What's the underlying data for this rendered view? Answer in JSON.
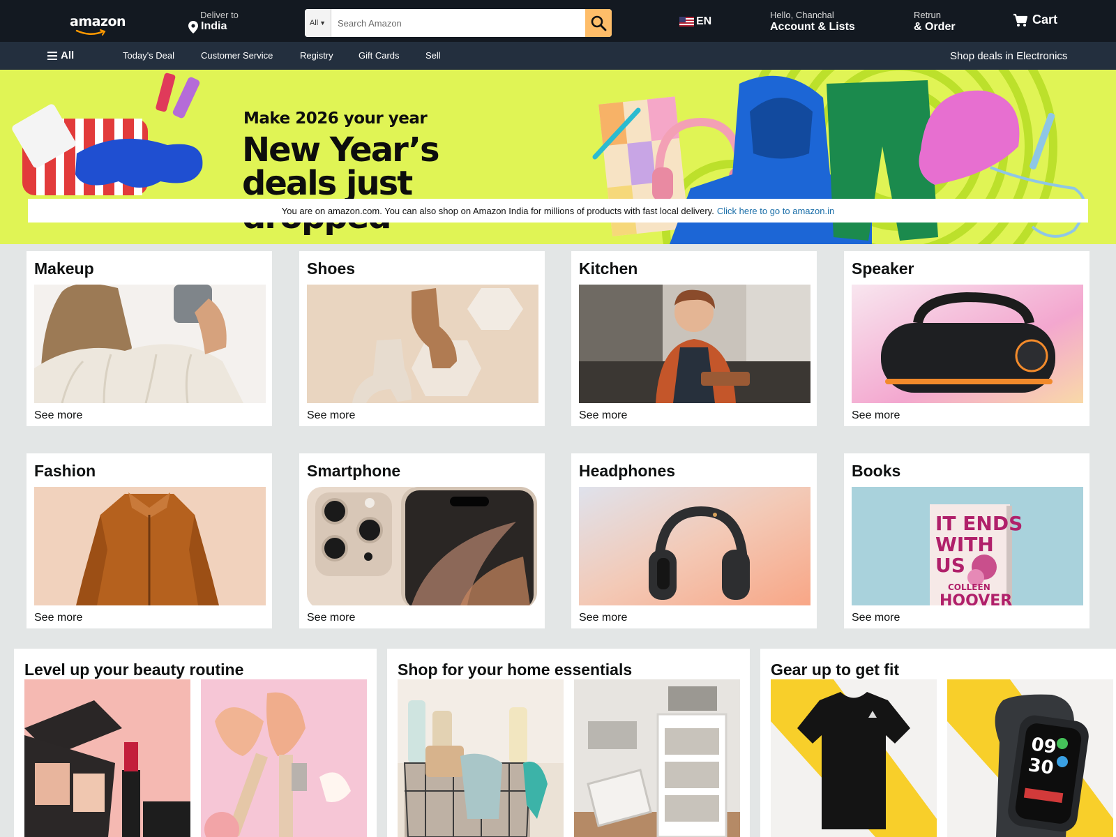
{
  "header": {
    "logo_text": "amazon",
    "deliver_label": "Deliver to",
    "deliver_location": "India",
    "search_category": "All",
    "search_placeholder": "Search Amazon",
    "language": "EN",
    "account_greeting": "Hello, Chanchal",
    "account_label": "Account & Lists",
    "orders_small": "Retrun",
    "orders_big": "& Order",
    "cart_label": "Cart"
  },
  "nav": {
    "all_label": "All",
    "items": [
      "Today's Deal",
      "Customer Service",
      "Registry",
      "Gift Cards",
      "Sell"
    ],
    "promo": "Shop deals in Electronics"
  },
  "hero": {
    "eyebrow": "Make 2026 your year",
    "title": "New Year’s deals just dropped",
    "notice_text": "You are on amazon.com. You can also shop on Amazon India for millions of products with fast local delivery.",
    "notice_link": "Click here to go to amazon.in",
    "background_color": "#e0f455"
  },
  "categories": [
    {
      "title": "Makeup",
      "link": "See more"
    },
    {
      "title": "Shoes",
      "link": "See more"
    },
    {
      "title": "Kitchen",
      "link": "See more"
    },
    {
      "title": "Speaker",
      "link": "See more"
    },
    {
      "title": "Fashion",
      "link": "See more"
    },
    {
      "title": "Smartphone",
      "link": "See more"
    },
    {
      "title": "Headphones",
      "link": "See more"
    },
    {
      "title": "Books",
      "link": "See more"
    }
  ],
  "book_cover": {
    "title": "IT ENDS WITH US",
    "author": "COLLEEN HOOVER"
  },
  "watch_face": {
    "hour": "09",
    "minute": "30"
  },
  "panels": [
    {
      "title": "Level up your beauty routine"
    },
    {
      "title": "Shop for your home essentials"
    },
    {
      "title": "Gear up to get fit"
    }
  ],
  "colors": {
    "header_bg": "#131921",
    "nav_bg": "#232f3e",
    "search_button": "#febd69",
    "link": "#1a6ea8",
    "page_bg": "#e3e6e6"
  }
}
